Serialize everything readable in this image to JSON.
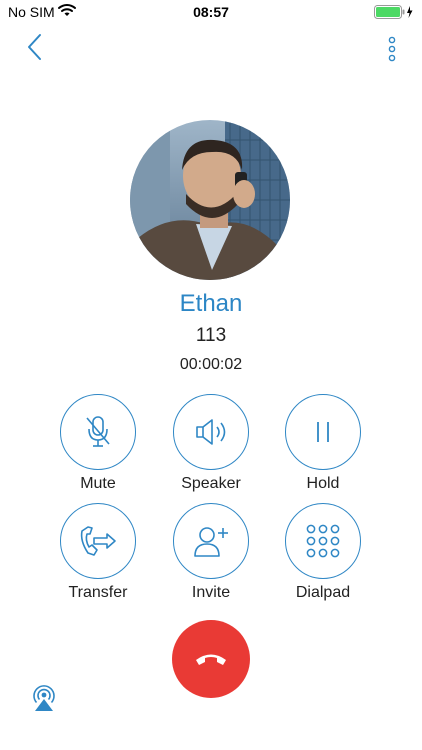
{
  "status_bar": {
    "carrier": "No SIM",
    "time": "08:57",
    "icons": [
      "wifi-icon",
      "battery-icon",
      "charging-bolt-icon"
    ]
  },
  "nav": {
    "back_icon": "chevron-left-icon",
    "more_icon": "vertical-dots-icon"
  },
  "contact": {
    "name": "Ethan",
    "number": "113",
    "duration": "00:00:02"
  },
  "controls": [
    {
      "label": "Mute",
      "icon": "microphone-muted-icon"
    },
    {
      "label": "Speaker",
      "icon": "speaker-icon"
    },
    {
      "label": "Hold",
      "icon": "pause-icon"
    },
    {
      "label": "Transfer",
      "icon": "phone-transfer-icon"
    },
    {
      "label": "Invite",
      "icon": "add-person-icon"
    },
    {
      "label": "Dialpad",
      "icon": "dialpad-icon"
    }
  ],
  "end_call": {
    "icon": "end-call-icon"
  },
  "audio_route": {
    "icon": "airplay-icon"
  },
  "colors": {
    "accent": "#2f87c5",
    "name": "#2c86c5",
    "end_call": "#e93a35",
    "battery": "#4cd964"
  }
}
